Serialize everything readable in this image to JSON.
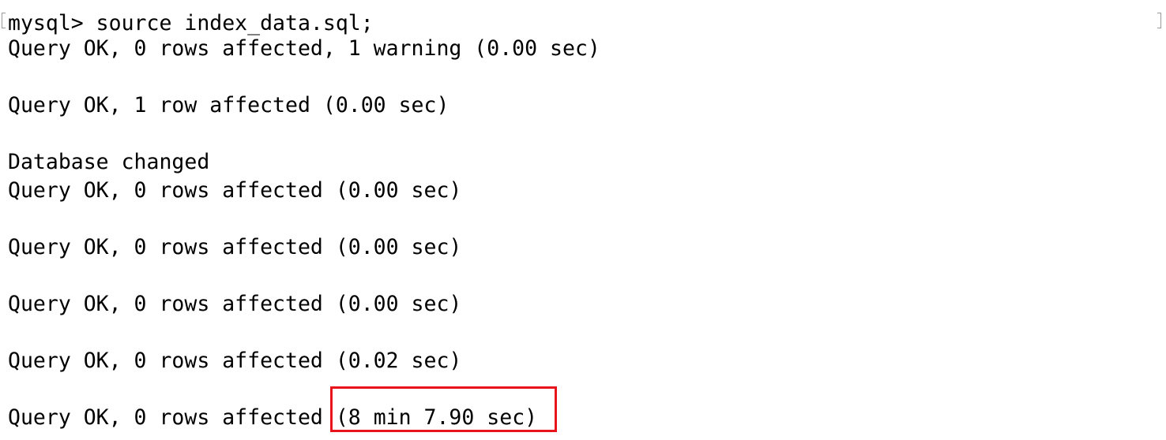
{
  "terminal": {
    "lines": [
      "mysql> source index_data.sql;",
      "Query OK, 0 rows affected, 1 warning (0.00 sec)",
      "",
      "Query OK, 1 row affected (0.00 sec)",
      "",
      "Database changed",
      "Query OK, 0 rows affected (0.00 sec)",
      "",
      "Query OK, 0 rows affected (0.00 sec)",
      "",
      "Query OK, 0 rows affected (0.00 sec)",
      "",
      "Query OK, 0 rows affected (0.02 sec)",
      "",
      "Query OK, 0 rows affected "
    ],
    "highlighted_timing": "(8 min 7.90 sec)",
    "highlight_color": "#e8131b"
  }
}
